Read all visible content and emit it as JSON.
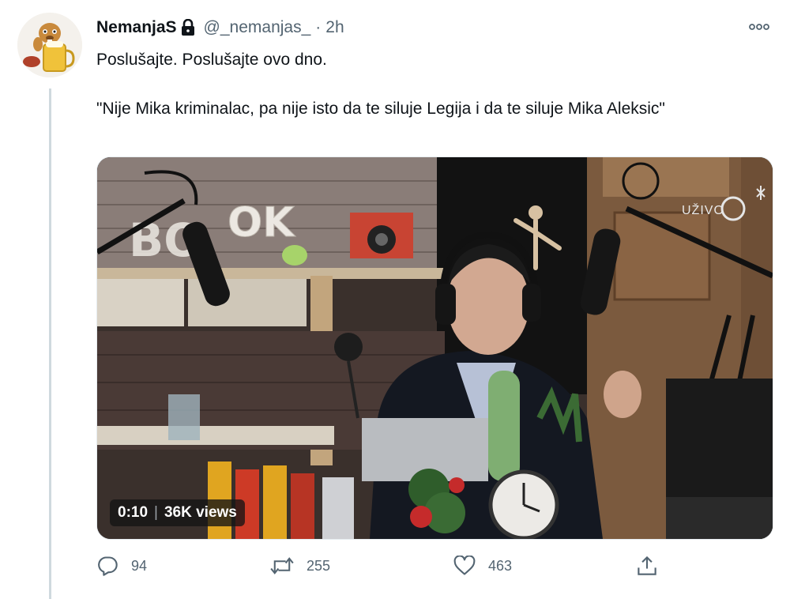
{
  "tweet": {
    "display_name": "NemanjaS",
    "handle": "@_nemanjas_",
    "separator": "·",
    "time": "2h",
    "text_line1": "Poslušajte. Poslušajte ovo dno.",
    "text_line2": "\"Nije Mika kriminalac, pa nije isto da te siluje Legija i da te siluje Mika Aleksic\""
  },
  "video": {
    "duration": "0:10",
    "views": "36K views",
    "overlay_live_text": "UŽIVO",
    "sign_text": "OK"
  },
  "actions": {
    "reply_count": "94",
    "retweet_count": "255",
    "like_count": "463"
  },
  "icons": {
    "lock": "lock-icon",
    "more": "more-icon",
    "reply": "reply-icon",
    "retweet": "retweet-icon",
    "like": "heart-icon",
    "share": "share-icon"
  },
  "colors": {
    "secondary_text": "#536471",
    "primary_text": "#0f1419",
    "thread_line": "#cfd9de"
  }
}
